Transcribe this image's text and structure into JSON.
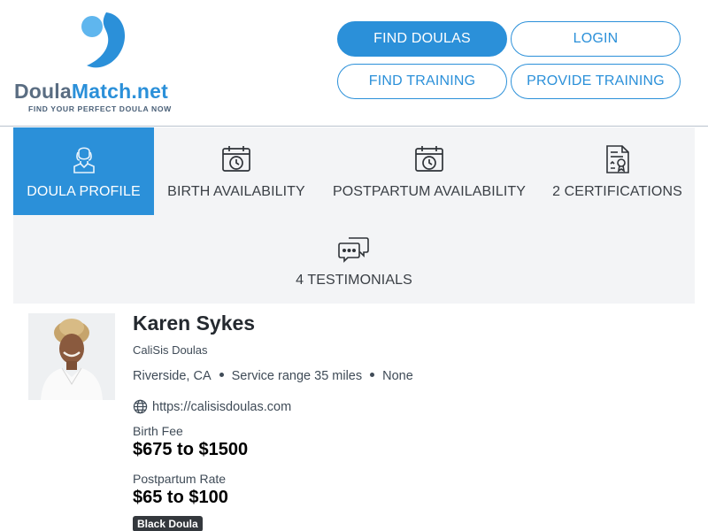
{
  "brand": {
    "name_part1": "Doula",
    "name_part2": "Match.net",
    "tagline": "FIND YOUR PERFECT DOULA NOW",
    "colors": {
      "primary": "#2b90d9",
      "dark": "#5a6d82"
    }
  },
  "nav": {
    "find_doulas": "FIND DOULAS",
    "login": "LOGIN",
    "find_training": "FIND TRAINING",
    "provide_training": "PROVIDE TRAINING"
  },
  "tabs": [
    {
      "label": "DOULA PROFILE",
      "icon": "doula-person-icon",
      "active": true
    },
    {
      "label": "BIRTH AVAILABILITY",
      "icon": "calendar-clock-icon",
      "active": false
    },
    {
      "label": "POSTPARTUM AVAILABILITY",
      "icon": "calendar-clock-icon",
      "active": false
    },
    {
      "label": "2 CERTIFICATIONS",
      "icon": "certificate-icon",
      "active": false
    },
    {
      "label": "4 TESTIMONIALS",
      "icon": "chat-bubbles-icon",
      "active": false
    }
  ],
  "profile": {
    "name": "Karen Sykes",
    "agency": "CaliSis Doulas",
    "location": "Riverside, CA",
    "service_range": "Service range 35 miles",
    "extra": "None",
    "website": "https://calisisdoulas.com",
    "birth_fee_label": "Birth Fee",
    "birth_fee": "$675 to $1500",
    "postpartum_label": "Postpartum Rate",
    "postpartum_rate": "$65 to $100",
    "badge": "Black Doula"
  }
}
